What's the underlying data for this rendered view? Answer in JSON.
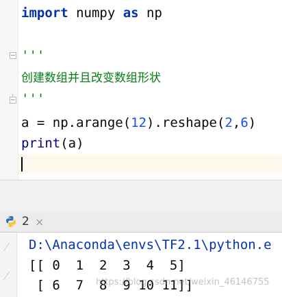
{
  "editor": {
    "lines": {
      "l1_import": "import",
      "l1_module": " numpy ",
      "l1_as": "as",
      "l1_alias": " np",
      "l3": "'''",
      "l4": "创建数组并且改变数组形状",
      "l5": "'''",
      "l6_a": "a = np.arange(",
      "l6_n1": "12",
      "l6_b": ").reshape(",
      "l6_n2": "2",
      "l6_c": ",",
      "l6_n3": "6",
      "l6_d": ")",
      "l7_print": "print",
      "l7_rest": "(a)"
    }
  },
  "run_panel": {
    "tab_label": "2",
    "tab_close": "×"
  },
  "console": {
    "path": "D:\\Anaconda\\envs\\TF2.1\\python.e",
    "row1": "[[ 0  1  2  3  4  5]",
    "row2": " [ 6  7  8  9 10 11]]"
  },
  "watermark": "https://blog.csdn.net/weixin_46146755"
}
